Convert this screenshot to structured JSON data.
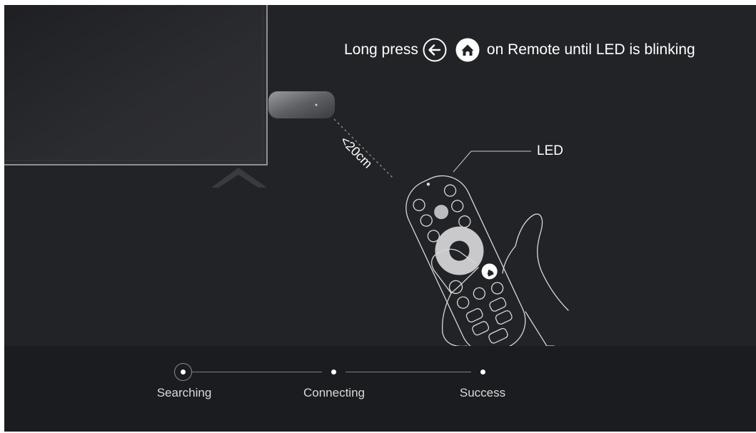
{
  "instruction": {
    "prefix": "Long press",
    "suffix": "on Remote until LED is blinking",
    "icons": [
      "back-arrow-icon",
      "home-icon"
    ]
  },
  "illustration": {
    "led_label": "LED",
    "distance_label": "<20cm"
  },
  "progress": {
    "steps": [
      {
        "label": "Searching",
        "state": "active"
      },
      {
        "label": "Connecting",
        "state": "pending"
      },
      {
        "label": "Success",
        "state": "pending"
      }
    ]
  },
  "colors": {
    "background": "#222327",
    "panel": "#1b1c1f",
    "text": "#ffffff",
    "line_art": "#d8d8d8"
  }
}
